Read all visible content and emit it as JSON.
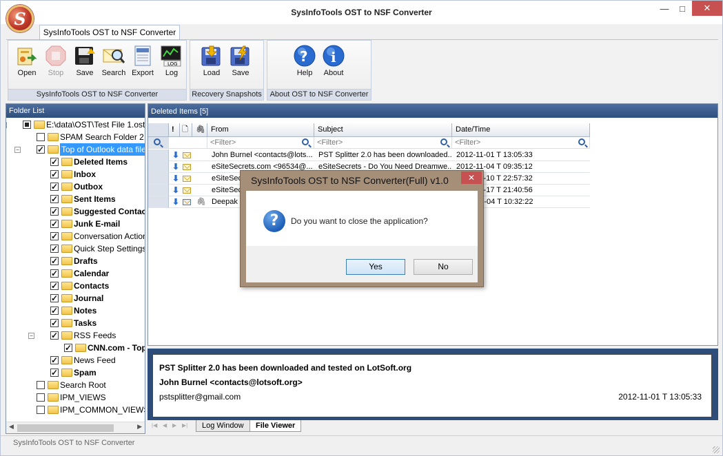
{
  "window": {
    "title": "SysInfoTools OST to NSF Converter",
    "controls": {
      "minimize": "—",
      "maximize": "□",
      "close": "✕"
    }
  },
  "ribbon": {
    "tab": "SysInfoTools OST to NSF Converter",
    "groups": [
      {
        "label": "SysInfoTools OST to NSF Converter",
        "buttons": [
          {
            "label": "Open",
            "icon": "open-icon"
          },
          {
            "label": "Stop",
            "icon": "stop-icon",
            "disabled": true
          },
          {
            "label": "Save",
            "icon": "save-icon"
          },
          {
            "label": "Search",
            "icon": "search-icon"
          },
          {
            "label": "Export",
            "icon": "export-icon"
          },
          {
            "label": "Log",
            "icon": "log-icon"
          }
        ]
      },
      {
        "label": "Recovery Snapshots",
        "buttons": [
          {
            "label": "Load",
            "icon": "load-icon"
          },
          {
            "label": "Save",
            "icon": "save-snapshot-icon"
          }
        ]
      },
      {
        "label": "About OST to NSF Converter",
        "buttons": [
          {
            "label": "Help",
            "icon": "help-icon"
          },
          {
            "label": "About",
            "icon": "about-icon"
          }
        ]
      }
    ]
  },
  "folder_pane": {
    "header": "Folder List",
    "items": [
      {
        "label": "E:\\data\\OST\\Test File 1.ost",
        "level": 0,
        "check": "partial",
        "expander": "−",
        "icon": "ost-file-icon",
        "bold": false
      },
      {
        "label": "SPAM Search Folder 2",
        "level": 1,
        "check": "none",
        "icon": "folder-icon",
        "bold": false
      },
      {
        "label": "Top of Outlook data file",
        "level": 1,
        "check": "checked",
        "expander": "−",
        "icon": "folder-icon",
        "bold": false,
        "selected": true
      },
      {
        "label": "Deleted Items",
        "level": 2,
        "check": "checked",
        "icon": "deleted-items-icon",
        "bold": true
      },
      {
        "label": "Inbox",
        "level": 2,
        "check": "checked",
        "icon": "inbox-icon",
        "bold": true
      },
      {
        "label": "Outbox",
        "level": 2,
        "check": "checked",
        "icon": "outbox-icon",
        "bold": true
      },
      {
        "label": "Sent Items",
        "level": 2,
        "check": "checked",
        "icon": "sent-items-icon",
        "bold": true
      },
      {
        "label": "Suggested Contacts",
        "level": 2,
        "check": "checked",
        "icon": "folder-icon",
        "bold": true
      },
      {
        "label": "Junk E-mail",
        "level": 2,
        "check": "checked",
        "icon": "junk-icon",
        "bold": true
      },
      {
        "label": "Conversation Action Settings",
        "level": 2,
        "check": "checked",
        "icon": "folder-icon",
        "bold": false
      },
      {
        "label": "Quick Step Settings",
        "level": 2,
        "check": "checked",
        "icon": "folder-icon",
        "bold": false
      },
      {
        "label": "Drafts",
        "level": 2,
        "check": "checked",
        "icon": "drafts-icon",
        "bold": true
      },
      {
        "label": "Calendar",
        "level": 2,
        "check": "checked",
        "icon": "calendar-icon",
        "bold": true
      },
      {
        "label": "Contacts",
        "level": 2,
        "check": "checked",
        "icon": "contacts-icon",
        "bold": true
      },
      {
        "label": "Journal",
        "level": 2,
        "check": "checked",
        "icon": "journal-icon",
        "bold": true
      },
      {
        "label": "Notes",
        "level": 2,
        "check": "checked",
        "icon": "notes-icon",
        "bold": true
      },
      {
        "label": "Tasks",
        "level": 2,
        "check": "checked",
        "icon": "tasks-icon",
        "bold": true
      },
      {
        "label": "RSS Feeds",
        "level": 2,
        "check": "checked",
        "expander": "−",
        "icon": "rss-icon",
        "bold": false
      },
      {
        "label": "CNN.com - Top Stories",
        "level": 3,
        "check": "checked",
        "icon": "folder-icon",
        "bold": true
      },
      {
        "label": "News Feed",
        "level": 2,
        "check": "checked",
        "icon": "folder-icon",
        "bold": false
      },
      {
        "label": "Spam",
        "level": 2,
        "check": "checked",
        "icon": "folder-icon",
        "bold": true
      },
      {
        "label": "Search Root",
        "level": 1,
        "check": "none",
        "icon": "folder-icon",
        "bold": false
      },
      {
        "label": "IPM_VIEWS",
        "level": 1,
        "check": "none",
        "icon": "folder-icon",
        "bold": false
      },
      {
        "label": "IPM_COMMON_VIEWS",
        "level": 1,
        "check": "none",
        "icon": "folder-icon",
        "bold": false
      }
    ]
  },
  "list_pane": {
    "header": "Deleted Items [5]",
    "columns": {
      "importance": "!",
      "type": "🗋",
      "attachment": "🖇",
      "from": "From",
      "subject": "Subject",
      "date": "Date/Time"
    },
    "filter_placeholder": "<Filter>",
    "rows": [
      {
        "from": "John Burnel <contacts@lots...",
        "subject": "PST Splitter 2.0 has been downloaded...",
        "date": "2012-11-01 T 13:05:33",
        "attach": false,
        "icon": "mail-icon"
      },
      {
        "from": "eSiteSecrets.com <96534@...",
        "subject": "eSiteSecrets - Do You Need Dreamwe...",
        "date": "2012-11-04 T 09:35:12",
        "attach": false,
        "icon": "mail-icon"
      },
      {
        "from": "eSiteSecr",
        "subject": "",
        "date": "2012-11-10 T 22:57:32",
        "attach": false,
        "icon": "mail-icon"
      },
      {
        "from": "eSiteSecr",
        "subject": "",
        "date": "2012-11-17 T 21:40:56",
        "attach": false,
        "icon": "mail-icon"
      },
      {
        "from": "Deepak",
        "subject": "",
        "date": "2013-01-04 T 10:32:22",
        "attach": true,
        "icon": "contact-card-icon"
      }
    ]
  },
  "preview": {
    "subject": "PST Splitter 2.0 has been downloaded and tested on LotSoft.org",
    "from": "John Burnel <contacts@lotsoft.org>",
    "to": "pstsplitter@gmail.com",
    "date": "2012-11-01 T 13:05:33"
  },
  "bottom_tabs": [
    {
      "label": "Log Window",
      "active": false
    },
    {
      "label": "File Viewer",
      "active": true
    }
  ],
  "status_bar": {
    "text": "SysInfoTools OST to NSF Converter"
  },
  "dialog": {
    "title": "SysInfoTools OST to NSF Converter(Full) v1.0",
    "close": "✕",
    "icon_glyph": "?",
    "message": "Do you want to close the application?",
    "yes": "Yes",
    "no": "No"
  }
}
